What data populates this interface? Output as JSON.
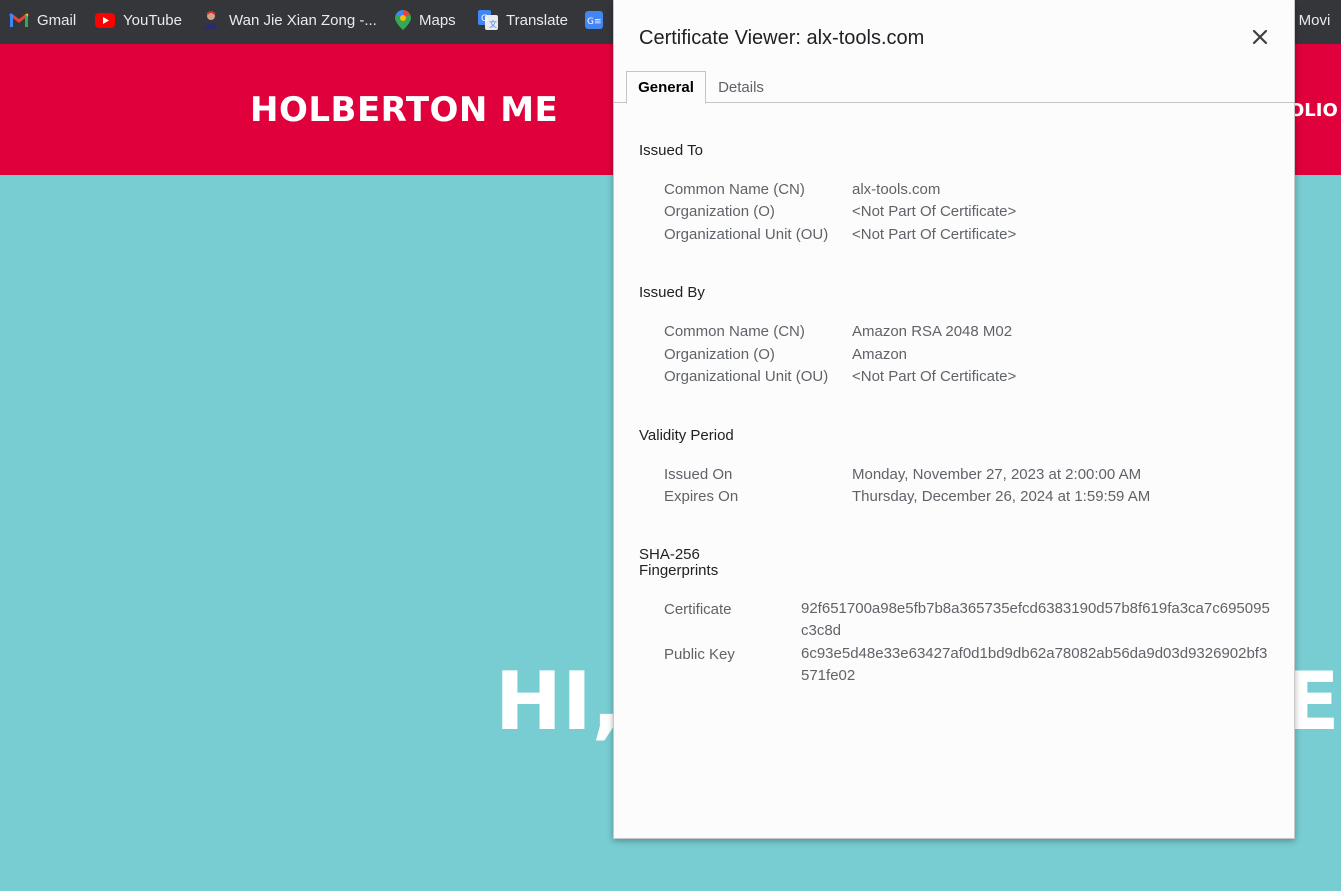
{
  "bookmarks": {
    "items": [
      {
        "label": "Gmail",
        "icon": "gmail-icon"
      },
      {
        "label": "YouTube",
        "icon": "youtube-icon"
      },
      {
        "label": "Wan Jie Xian Zong -...",
        "icon": "avatar-icon"
      },
      {
        "label": "Maps",
        "icon": "maps-pin-icon"
      },
      {
        "label": "Translate",
        "icon": "translate-icon"
      },
      {
        "label": "",
        "icon": "docs-icon"
      },
      {
        "label": "th Movi",
        "icon": ""
      }
    ]
  },
  "site": {
    "title": "HOLBERTON ME",
    "nav_fragment": "OLIO",
    "hero_left": "HI,",
    "hero_right": "ER",
    "colors": {
      "header": "#e0003b",
      "background": "#77cdd1"
    }
  },
  "dialog": {
    "title": "Certificate Viewer: alx-tools.com",
    "close_icon": "close-icon",
    "tabs": [
      {
        "label": "General",
        "active": true
      },
      {
        "label": "Details",
        "active": false
      }
    ],
    "issued_to": {
      "heading": "Issued To",
      "rows": [
        {
          "label": "Common Name (CN)",
          "value": "alx-tools.com"
        },
        {
          "label": "Organization (O)",
          "value": "<Not Part Of Certificate>"
        },
        {
          "label": "Organizational Unit (OU)",
          "value": "<Not Part Of Certificate>"
        }
      ]
    },
    "issued_by": {
      "heading": "Issued By",
      "rows": [
        {
          "label": "Common Name (CN)",
          "value": "Amazon RSA 2048 M02"
        },
        {
          "label": "Organization (O)",
          "value": "Amazon"
        },
        {
          "label": "Organizational Unit (OU)",
          "value": "<Not Part Of Certificate>"
        }
      ]
    },
    "validity": {
      "heading": "Validity Period",
      "rows": [
        {
          "label": "Issued On",
          "value": "Monday, November 27, 2023 at 2:00:00 AM"
        },
        {
          "label": "Expires On",
          "value": "Thursday, December 26, 2024 at 1:59:59 AM"
        }
      ]
    },
    "fingerprints": {
      "heading_line1": "SHA-256",
      "heading_line2": "Fingerprints",
      "rows": [
        {
          "label": "Certificate",
          "value": "92f651700a98e5fb7b8a365735efcd6383190d57b8f619fa3ca7c695095c3c8d"
        },
        {
          "label": "Public Key",
          "value": "6c93e5d48e33e63427af0d1bd9db62a78082ab56da9d03d9326902bf3571fe02"
        }
      ]
    }
  }
}
